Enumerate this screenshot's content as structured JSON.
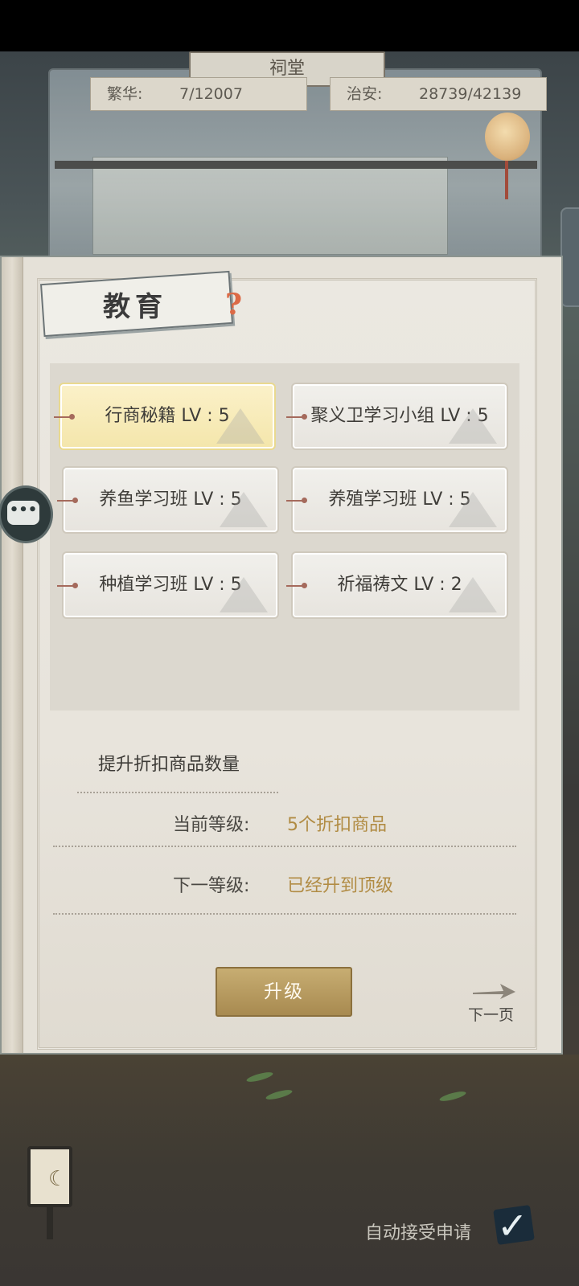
{
  "header": {
    "prosperity_label": "繁华:",
    "prosperity_value": "7/12007",
    "security_label": "治安:",
    "security_value": "28739/42139"
  },
  "building_sign": "祠堂",
  "panel": {
    "title": "教育",
    "help_icon": "?",
    "skills": [
      {
        "label": "行商秘籍 LV : 5",
        "selected": true
      },
      {
        "label": "聚义卫学习小组 LV : 5",
        "selected": false
      },
      {
        "label": "养鱼学习班 LV : 5",
        "selected": false
      },
      {
        "label": "养殖学习班 LV : 5",
        "selected": false
      },
      {
        "label": "种植学习班 LV : 5",
        "selected": false
      },
      {
        "label": "祈福祷文 LV : 2",
        "selected": false
      }
    ],
    "description": "提升折扣商品数量",
    "current_level_label": "当前等级:",
    "current_level_value": "5个折扣商品",
    "next_level_label": "下一等级:",
    "next_level_value": "已经升到顶级",
    "upgrade_button": "升级",
    "next_page": "下一页"
  },
  "chat_icon": "chat-bubble-icon",
  "footer": {
    "auto_accept_label": "自动接受申请",
    "auto_accept_checked": true
  },
  "colors": {
    "accent_gold": "#b18c44",
    "button_gold": "#a88a50",
    "help_orange": "#dc6a46",
    "selected_highlight": "#f4e6ab"
  }
}
